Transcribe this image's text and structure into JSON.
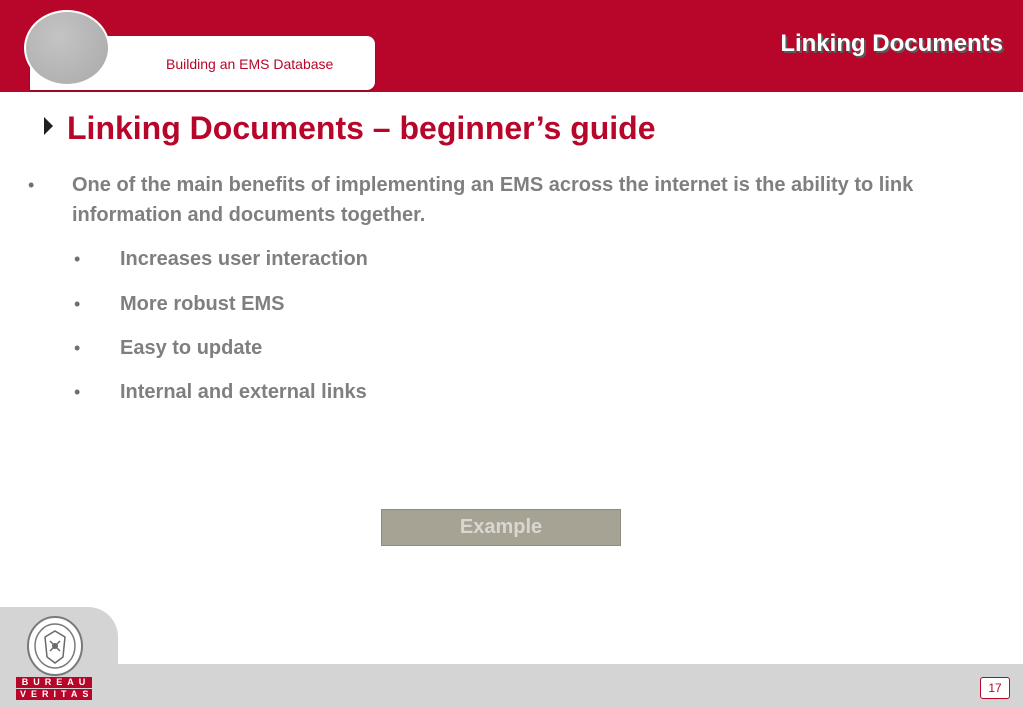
{
  "header": {
    "subtitle": "Building an EMS Database",
    "title": "Linking Documents"
  },
  "slide": {
    "title": "Linking Documents – beginner’s guide",
    "main_bullet": "One of the main benefits of implementing an EMS across the internet is the ability to link information and documents together.",
    "bullet_symbol": "•",
    "sub_items": [
      "Increases user interaction",
      "More robust EMS",
      "Easy to update",
      "Internal and external links"
    ],
    "example_label": "Example"
  },
  "footer": {
    "logo_line1": "BUREAU",
    "logo_line2": "VERITAS",
    "page_number": "17"
  },
  "colors": {
    "brand_red": "#b8062b",
    "text_gray": "#7f7f7f",
    "footer_gray": "#d4d4d4",
    "button_khaki": "#a7a394"
  },
  "icons": {
    "title_marker": "triangle-right-icon",
    "logo": "bureau-veritas-seal-icon"
  }
}
